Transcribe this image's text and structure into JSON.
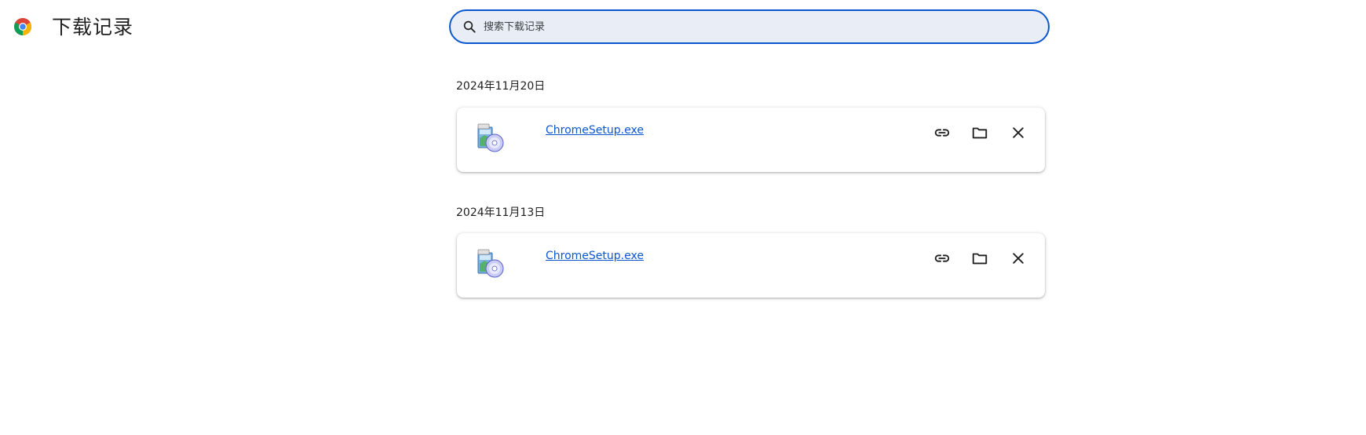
{
  "header": {
    "title": "下载记录",
    "logo_icon": "chrome-logo-icon"
  },
  "search": {
    "placeholder": "搜索下载记录",
    "value": "",
    "icon": "search-icon",
    "border_color": "#0b57d0",
    "background": "#e9eef6"
  },
  "groups": [
    {
      "date": "2024年11月20日",
      "items": [
        {
          "file_name": "ChromeSetup.exe",
          "file_icon": "installer-icon",
          "actions": [
            "copy-link-icon",
            "folder-icon",
            "close-icon"
          ]
        }
      ]
    },
    {
      "date": "2024年11月13日",
      "items": [
        {
          "file_name": "ChromeSetup.exe",
          "file_icon": "installer-icon",
          "actions": [
            "copy-link-icon",
            "folder-icon",
            "close-icon"
          ]
        }
      ]
    }
  ],
  "colors": {
    "link": "#0b57d0",
    "text": "#1f1f1f"
  }
}
